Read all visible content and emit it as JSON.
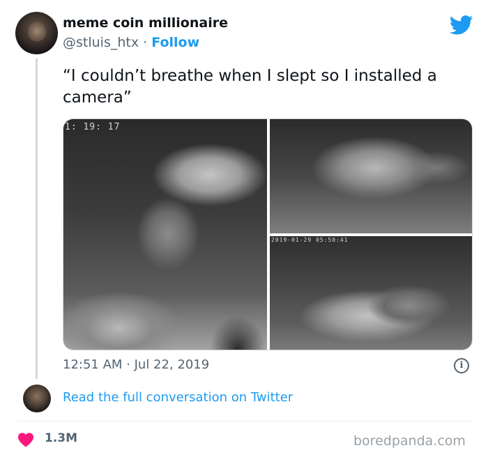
{
  "author": {
    "display_name": "meme coin millionaire",
    "handle": "@stluis_htx",
    "separator": "·",
    "follow_label": "Follow"
  },
  "tweet": {
    "text": "“I couldn’t breathe when I slept so I installed a camera”",
    "timestamp": "12:51 AM · Jul 22, 2019"
  },
  "media": {
    "photos": [
      {
        "subject": "cat sleeping on man's face",
        "camera_stamp": "1: 19: 17"
      },
      {
        "subject": "cat lying on sleeping man",
        "camera_stamp": ""
      },
      {
        "subject": "cat on sleeping man's head",
        "camera_stamp": "2019-01-29  05:50:41"
      }
    ]
  },
  "thread": {
    "read_full_label": "Read the full conversation on Twitter"
  },
  "engagement": {
    "likes": "1.3M"
  },
  "watermark": "boredpanda.com",
  "icons": {
    "brand": "twitter-bird-icon",
    "like": "heart-icon",
    "info": "info-icon"
  },
  "colors": {
    "twitter_blue": "#1d9bf0",
    "heart_pink": "#f91880",
    "secondary_text": "#536471"
  }
}
